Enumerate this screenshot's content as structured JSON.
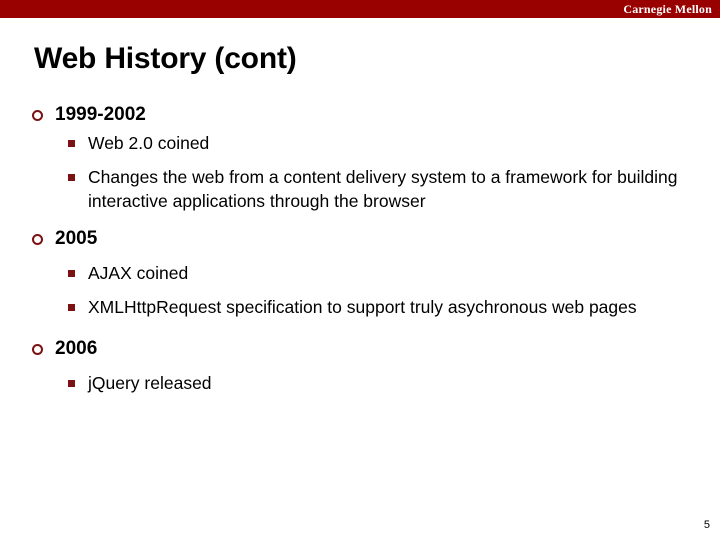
{
  "header": {
    "brand": "Carnegie Mellon",
    "bar_color": "#990000"
  },
  "title": "Web History (cont)",
  "accent_color": "#7b1113",
  "bullet_icons": {
    "level1": "hollow-circle-bullet",
    "level2": "filled-square-bullet"
  },
  "sections": [
    {
      "heading": "1999-2002",
      "items": [
        "Web 2.0 coined",
        "Changes the web from a content delivery system to a framework for building interactive applications through the browser"
      ]
    },
    {
      "heading": "2005",
      "items": [
        "AJAX coined",
        "XMLHttpRequest  specification to support truly asychronous web pages"
      ]
    },
    {
      "heading": "2006",
      "items": [
        "jQuery released"
      ]
    }
  ],
  "footer": {
    "page_number": "5"
  }
}
